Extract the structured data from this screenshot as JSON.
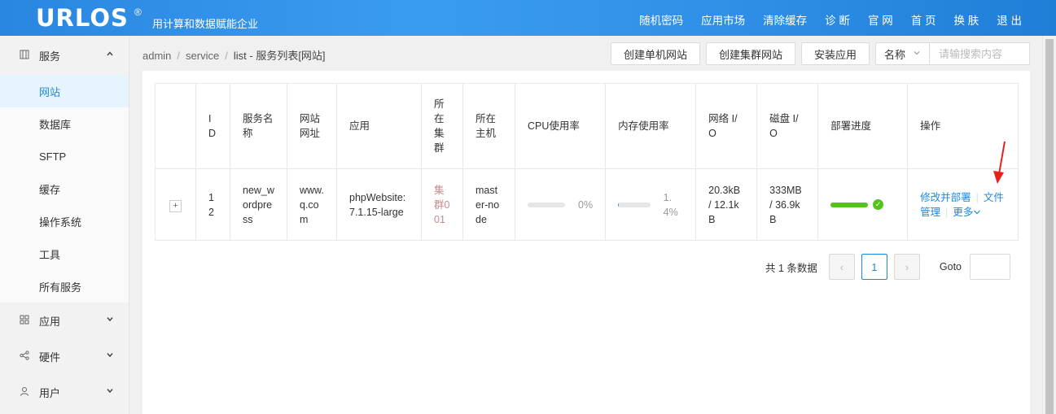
{
  "header": {
    "logo": "URLOS",
    "reg": "®",
    "tagline": "用计算和数据赋能企业",
    "nav": [
      "随机密码",
      "应用市场",
      "清除缓存",
      "诊 断",
      "官 网",
      "首 页",
      "换 肤",
      "退 出"
    ]
  },
  "sidebar": {
    "service_group": "服务",
    "service_items": [
      "网站",
      "数据库",
      "SFTP",
      "缓存",
      "操作系统",
      "工具",
      "所有服务"
    ],
    "app_group": "应用",
    "hardware_group": "硬件",
    "user_group": "用户"
  },
  "breadcrumb": [
    "admin",
    "service",
    "list",
    "服务列表[网站]"
  ],
  "toolbar": {
    "create_single": "创建单机网站",
    "create_cluster": "创建集群网站",
    "install_app": "安装应用",
    "search_field": "名称",
    "search_placeholder": "请输搜索内容"
  },
  "table": {
    "headers": [
      "ID",
      "服务名称",
      "网站网址",
      "应用",
      "所在集群",
      "所在主机",
      "CPU使用率",
      "内存使用率",
      "网络 I/O",
      "磁盘 I/O",
      "部署进度",
      "操作"
    ],
    "rows": [
      {
        "expand": "+",
        "id": "12",
        "name": "new_wordpress",
        "url": "www.q.com",
        "app": "phpWebsite:7.1.15-large",
        "cluster": "集群001",
        "host": "master-node",
        "cpu": "0%",
        "cpu_fraction": 0.0,
        "mem": "1.4%",
        "mem_fraction": 0.014,
        "net": "20.3kB / 12.1kB",
        "disk": "333MB / 36.9kB",
        "deploy_fraction": 1.0,
        "op_modify": "修改并部署",
        "op_files": "文件管理",
        "op_more": "更多"
      }
    ]
  },
  "pagination": {
    "total_text": "共 1 条数据",
    "current_page": "1",
    "prev": "‹",
    "next": "›",
    "goto_label": "Goto"
  },
  "colors": {
    "header_blue": "#2f8fe6",
    "link_blue": "#1e88e5",
    "success_green": "#52c41a",
    "annotation_red": "#e8201b"
  }
}
